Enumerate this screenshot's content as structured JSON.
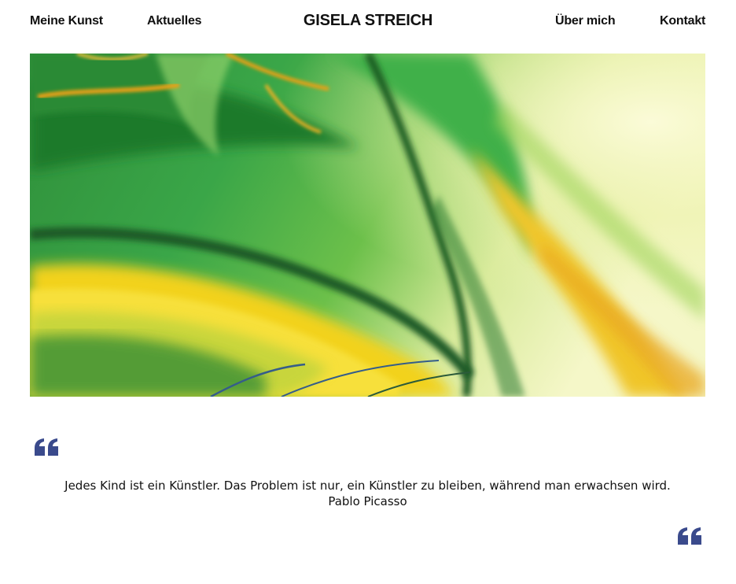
{
  "nav": {
    "items_left": [
      {
        "label": "Meine Kunst"
      },
      {
        "label": "Aktuelles"
      }
    ],
    "site_title": "GISELA STREICH",
    "items_right": [
      {
        "label": "Über mich"
      },
      {
        "label": "Kontakt"
      }
    ]
  },
  "hero": {
    "image": "abstract-painting-green-yellow"
  },
  "quote": {
    "text": "Jedes Kind ist ein Künstler. Das Problem ist nur, ein Künstler zu bleiben, während man erwachsen wird.",
    "author": "Pablo Picasso",
    "icon": "quote-mark-icon",
    "icon_color": "#3a4a8c"
  }
}
